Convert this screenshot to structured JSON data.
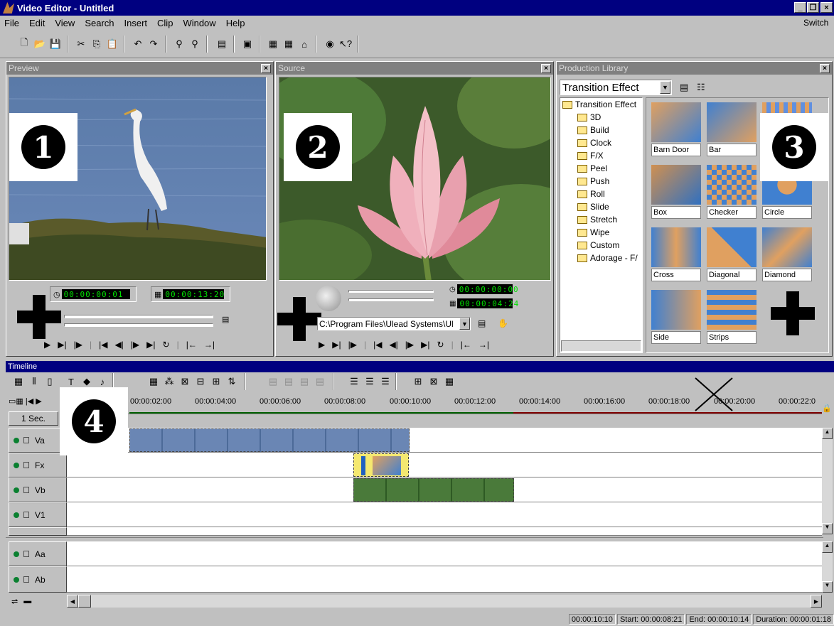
{
  "window": {
    "title": "Video Editor - Untitled",
    "min": "_",
    "max": "❐",
    "close": "×"
  },
  "menu": {
    "items": [
      "File",
      "Edit",
      "View",
      "Search",
      "Insert",
      "Clip",
      "Window",
      "Help"
    ],
    "switch": "Switch"
  },
  "preview": {
    "title": "Preview",
    "badge": "1",
    "timecode_current": "00:00:00:01",
    "timecode_total": "00:00:13:20"
  },
  "source": {
    "title": "Source",
    "badge": "2",
    "timecode_1": "00:00:00:00",
    "timecode_2": "00:00:04:24",
    "path": "C:\\Program Files\\Ulead Systems\\Ul"
  },
  "library": {
    "title": "Production Library",
    "category": "Transition Effect",
    "badge": "3",
    "tree_root": "Transition Effect",
    "tree": [
      "3D",
      "Build",
      "Clock",
      "F/X",
      "Peel",
      "Push",
      "Roll",
      "Slide",
      "Stretch",
      "Wipe",
      "Custom",
      "Adorage - F/"
    ],
    "thumbs": [
      "Barn Door",
      "Bar",
      "Box",
      "Checker",
      "Circle",
      "Cross",
      "Diagonal",
      "Diamond",
      "Side",
      "Strips"
    ]
  },
  "timeline": {
    "title": "Timeline",
    "badge": "4",
    "scale": "1 Sec.",
    "ruler": [
      "00:00:02:00",
      "00:00:04:00",
      "00:00:06:00",
      "00:00:08:00",
      "00:00:10:00",
      "00:00:12:00",
      "00:00:14:00",
      "00:00:16:00",
      "00:00:18:00",
      "00:00:20:00",
      "00:00:22:0"
    ],
    "tracks": [
      "Va",
      "Fx",
      "Vb",
      "V1",
      "Aa",
      "Ab"
    ]
  },
  "status": {
    "time": "00:00:10:10",
    "start": "Start: 00:00:08:21",
    "end": "End: 00:00:10:14",
    "duration": "Duration: 00:00:01:18"
  }
}
